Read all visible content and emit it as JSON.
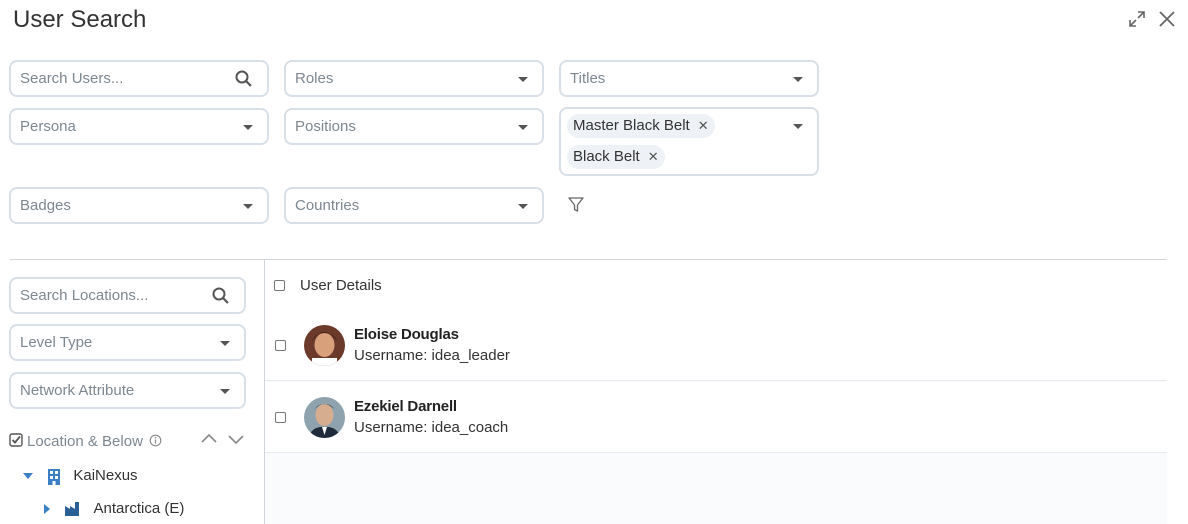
{
  "header": {
    "title": "User Search",
    "expand_icon": "expand-icon",
    "close_icon": "close-icon"
  },
  "filters": {
    "search_users": {
      "placeholder": "Search Users...",
      "value": ""
    },
    "roles": {
      "placeholder": "Roles"
    },
    "titles": {
      "placeholder": "Titles"
    },
    "persona": {
      "placeholder": "Persona"
    },
    "positions": {
      "placeholder": "Positions"
    },
    "selected_titles": [
      {
        "label": "Master Black Belt"
      },
      {
        "label": "Black Belt"
      }
    ],
    "badges": {
      "placeholder": "Badges"
    },
    "countries": {
      "placeholder": "Countries"
    }
  },
  "locations": {
    "search": {
      "placeholder": "Search Locations...",
      "value": ""
    },
    "level_type": {
      "placeholder": "Level Type"
    },
    "network_attribute": {
      "placeholder": "Network Attribute"
    },
    "location_and_below": {
      "label": "Location & Below",
      "checked": true
    },
    "tree": [
      {
        "label": "KaiNexus",
        "expanded": true,
        "icon": "building-icon"
      },
      {
        "label": "Antarctica (E)",
        "expanded": false,
        "icon": "factory-icon"
      }
    ]
  },
  "grid": {
    "header_label": "User Details",
    "rows": [
      {
        "name": "Eloise Douglas",
        "username": "Username: idea_leader"
      },
      {
        "name": "Ezekiel Darnell",
        "username": "Username: idea_coach"
      }
    ]
  },
  "colors": {
    "accent": "#3a7fc4",
    "border": "#d8dfe6",
    "tag_bg": "#eef2f6"
  }
}
